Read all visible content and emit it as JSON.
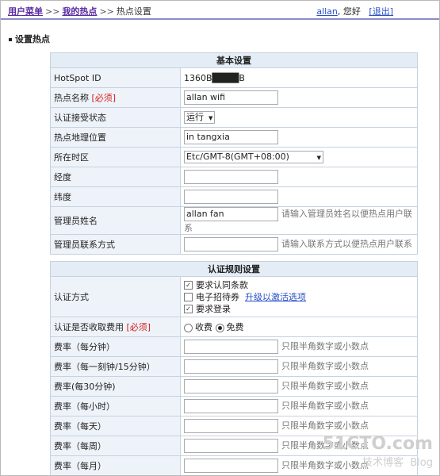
{
  "nav": {
    "menu": "用户菜单",
    "sep1": ">>",
    "hotspots": "我的热点",
    "sep2": ">>",
    "current": "热点设置",
    "user": "allan",
    "greeting": ", 您好",
    "logout": "[退出]"
  },
  "page_title": "设置热点",
  "basic": {
    "header": "基本设置",
    "hotspot_id_label": "HotSpot ID",
    "hotspot_id_value": "1360B████B",
    "name_label": "热点名称",
    "required": "[必须]",
    "name_value": "allan wifi",
    "auth_status_label": "认证接受状态",
    "auth_status_value": "运行",
    "location_label": "热点地理位置",
    "location_value": "in tangxia",
    "timezone_label": "所在时区",
    "timezone_value": "Etc/GMT-8(GMT+08:00)",
    "longitude_label": "经度",
    "latitude_label": "纬度",
    "admin_name_label": "管理员姓名",
    "admin_name_value": "allan fan",
    "admin_name_hint": "请输入管理员姓名以便热点用户联系",
    "admin_contact_label": "管理员联系方式",
    "admin_contact_hint": "请输入联系方式以便热点用户联系"
  },
  "auth": {
    "header": "认证规则设置",
    "method_label": "认证方式",
    "opt_terms": "要求认同条款",
    "opt_coupon": "电子招待券",
    "upgrade_link": "升级以激活选项",
    "opt_login": "要求登录",
    "fee_label": "认证是否收取费用",
    "required": "[必须]",
    "fee_charge": "收费",
    "fee_free": "免费",
    "rate_hint": "只限半角数字或小数点",
    "rates": [
      "费率（每分钟）",
      "费率（每一刻钟/15分钟）",
      "费率(每30分钟)",
      "费率（每小时）",
      "费率（每天）",
      "费率（每周）",
      "费率（每月）"
    ]
  },
  "watermark": {
    "site": "51CTO.com",
    "tagline": "技术博客",
    "blog": "Blog"
  }
}
